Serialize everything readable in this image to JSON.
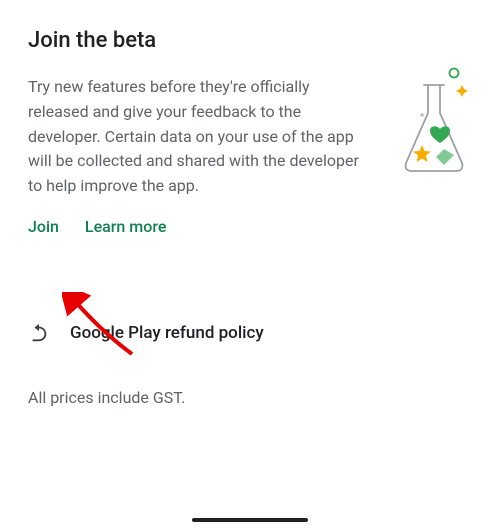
{
  "beta": {
    "title": "Join the beta",
    "description": "Try new features before they're officially released and give your feedback to the developer. Certain data on your use of the app will be collected and shared with the developer to help improve the app.",
    "join_label": "Join",
    "learn_more_label": "Learn more"
  },
  "refund": {
    "label": "Google Play refund policy"
  },
  "gst_note": "All prices include GST.",
  "colors": {
    "accent": "#118052",
    "text_muted": "#5f6368"
  }
}
